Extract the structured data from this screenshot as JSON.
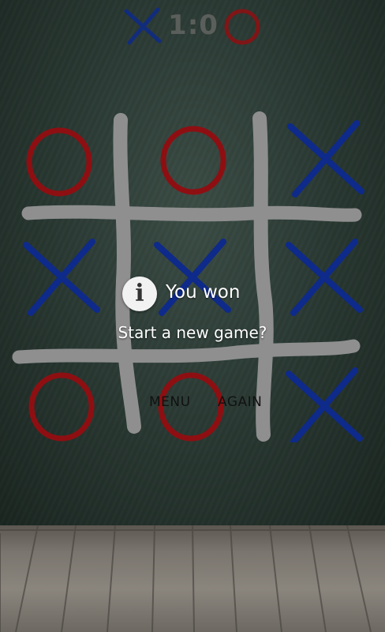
{
  "scoreboard": {
    "player_x_icon": "x-mark-icon",
    "player_o_icon": "o-mark-icon",
    "score": "1:0"
  },
  "board": {
    "cells": [
      "O",
      "O",
      "X",
      "X",
      "X",
      "X",
      "O",
      "O",
      "X"
    ]
  },
  "dialog": {
    "icon": "info-icon",
    "icon_glyph": "i",
    "title": "You won",
    "message": "Start a new game?",
    "buttons": [
      "MENU",
      "AGAIN"
    ]
  },
  "colors": {
    "x_mark": "#0e2a8a",
    "o_mark": "#8e0f12",
    "chalk_grid": "#8f8f8f",
    "score_text": "#5b5f5c"
  }
}
